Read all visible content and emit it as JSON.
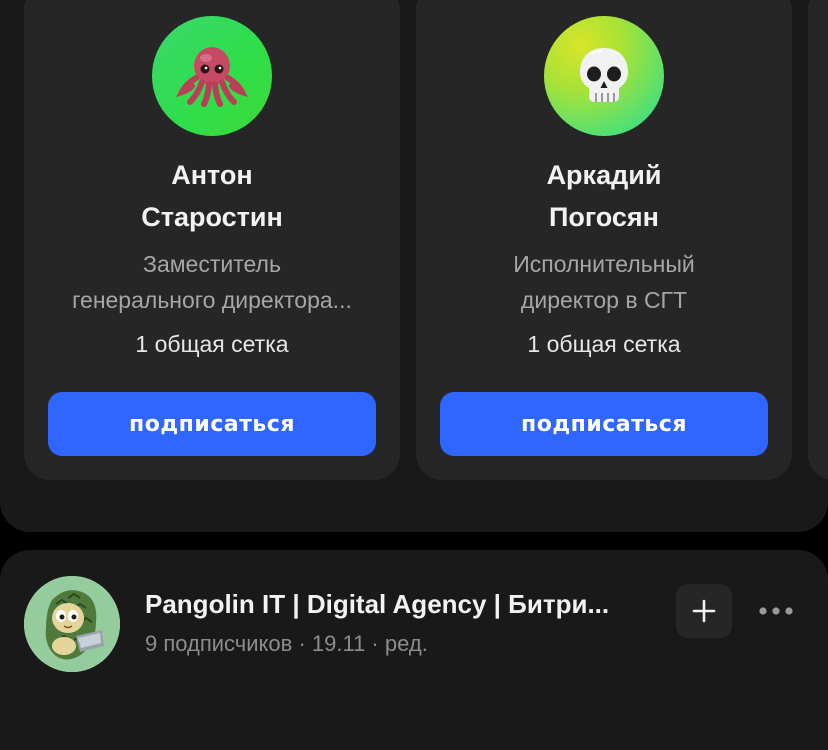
{
  "recommendations": [
    {
      "name_line1": "Антон",
      "name_line2": "Старостин",
      "role_line1": "Заместитель",
      "role_line2": "генерального директора...",
      "common": "1 общая сетка",
      "button_label": "подписаться",
      "avatar_icon": "octopus-emoji-icon"
    },
    {
      "name_line1": "Аркадий",
      "name_line2": "Погосян",
      "role_line1": "Исполнительный",
      "role_line2": "директор в СГТ",
      "common": "1 общая сетка",
      "button_label": "подписаться",
      "avatar_icon": "skull-emoji-icon"
    }
  ],
  "post": {
    "author": "Pangolin IT | Digital Agency | Битри...",
    "meta": "9 подписчиков · 19.11 · ред.",
    "avatar_icon": "pangolin-logo-icon",
    "add_icon": "plus-icon",
    "more_icon": "more-dots-icon"
  },
  "colors": {
    "background": "#000000",
    "panel": "#191919",
    "card": "#262626",
    "accent": "#2f66ff",
    "primary_text": "#f2f2f2",
    "secondary_text": "#a6a6a6"
  }
}
